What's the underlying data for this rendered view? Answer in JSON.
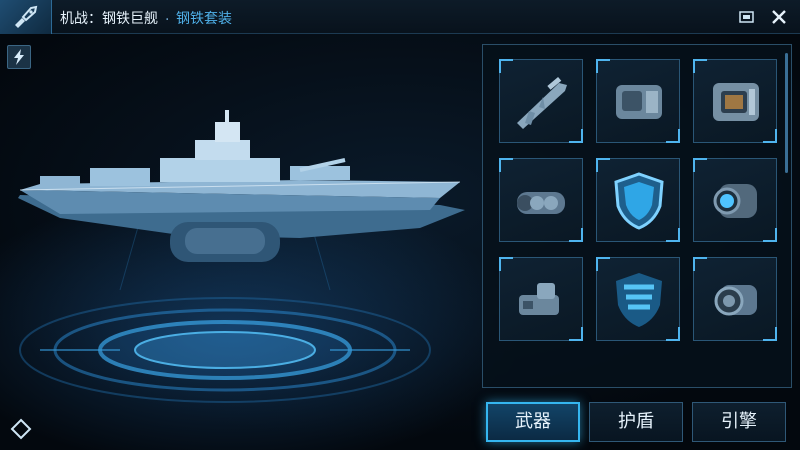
{
  "header": {
    "title": "机战：钢铁巨舰",
    "separator": ".",
    "subtitle": "钢铁套装"
  },
  "icons": {
    "logo": "wrench-rocket-icon",
    "minimize": "window-restore-icon",
    "close": "close-icon",
    "back": "lightning-back-icon",
    "bottom_left": "diamond-icon"
  },
  "equipment_slots": [
    {
      "item": "assault-rifle"
    },
    {
      "item": "armor-module"
    },
    {
      "item": "engine-block"
    },
    {
      "item": "cannon-barrel"
    },
    {
      "item": "shield"
    },
    {
      "item": "thruster"
    },
    {
      "item": "scope-module"
    },
    {
      "item": "shield-striped"
    },
    {
      "item": "jet-engine"
    }
  ],
  "tabs": [
    {
      "label": "武器",
      "active": true
    },
    {
      "label": "护盾",
      "active": false
    },
    {
      "label": "引擎",
      "active": false
    }
  ],
  "colors": {
    "accent": "#35b6f0",
    "subtitle": "#4fb0e8",
    "background": "#050c14"
  }
}
